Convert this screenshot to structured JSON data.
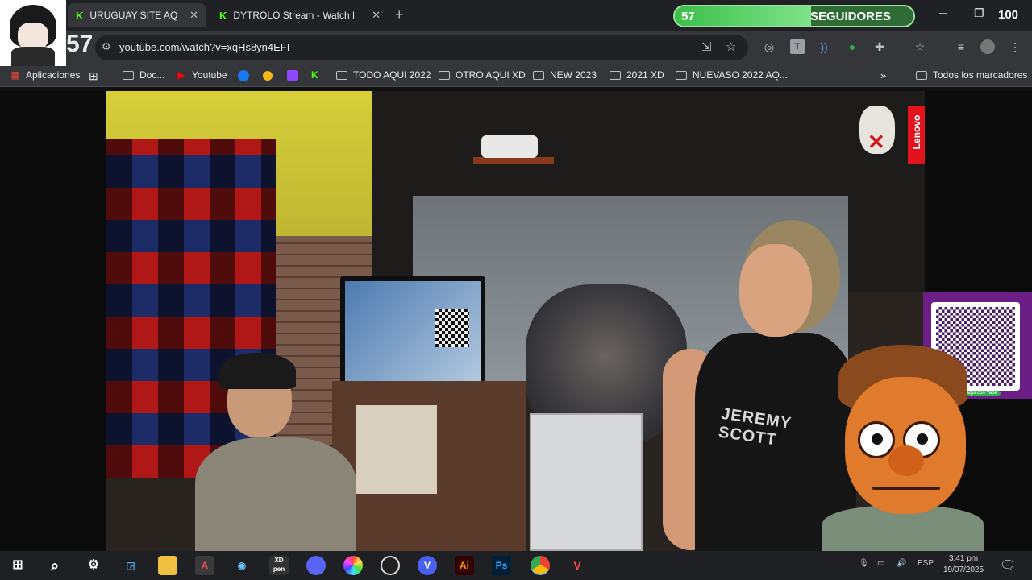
{
  "tabs": [
    {
      "title": "URUGUAY SITE AQUI V...",
      "active": true
    },
    {
      "title": "DYTROLO Stream - Watch Live",
      "active": false
    }
  ],
  "new_tab_symbol": "+",
  "follower_goal": {
    "current": "57",
    "label": "SEGUIDORES",
    "goal": "100",
    "progress": 0.57
  },
  "window_controls": {
    "minimize": "─",
    "restore": "❐",
    "close": "✕"
  },
  "omnibox": {
    "url": "youtube.com/watch?v=xqHs8yn4EFI"
  },
  "bookmarks": [
    {
      "label": "Aplicaciones",
      "icon": "apps-icon"
    },
    {
      "label": "Doc...",
      "icon": "folder-icon"
    },
    {
      "label": "Youtube",
      "icon": "youtube-icon"
    },
    {
      "label": "TODO AQUI 2022",
      "icon": "folder-icon"
    },
    {
      "label": "OTRO AQUI XD",
      "icon": "folder-icon"
    },
    {
      "label": "NEW 2023",
      "icon": "folder-icon"
    },
    {
      "label": "2021 XD",
      "icon": "folder-icon"
    },
    {
      "label": "NUEVASO 2022 AQ...",
      "icon": "folder-icon"
    },
    {
      "label": "Todos los marcadores",
      "icon": "folder-icon"
    }
  ],
  "stream": {
    "overlay_count": "57",
    "shirt_text": "JEREMY SCOTT",
    "brand": "Lenovo",
    "qr_caption": "Pagá aquí con Yape"
  },
  "taskbar": {
    "apps": [
      "start-icon",
      "search-icon",
      "settings-icon",
      "screenshot-icon",
      "file-explorer-icon",
      "app-a-icon",
      "steam-icon",
      "xdpen-icon",
      "discord-icon",
      "color-icon",
      "obs-icon",
      "v-icon",
      "illustrator-icon",
      "photoshop-icon",
      "chrome-icon",
      "valorant-icon"
    ],
    "xdpen_label": "XD pen",
    "ai_label": "Ai",
    "ps_label": "Ps",
    "v_label": "V",
    "lang": "ESP",
    "time": "3:41 pm",
    "date": "19/07/2025"
  }
}
